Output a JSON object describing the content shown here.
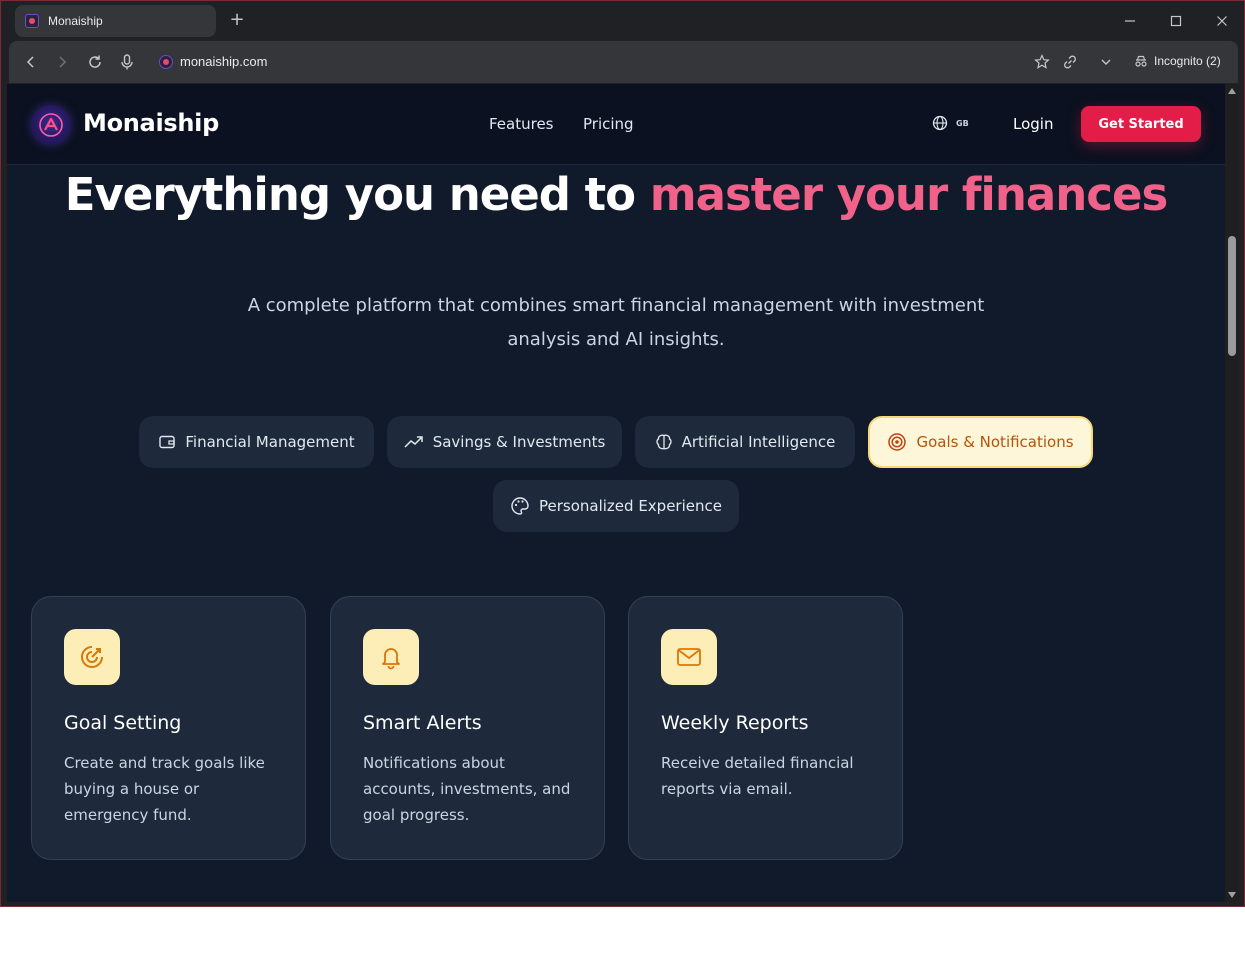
{
  "browser": {
    "tab_title": "Monaiship",
    "new_tab": "+",
    "url": "monaiship.com",
    "incognito_label": "Incognito (2)"
  },
  "site": {
    "brand": "Monaiship",
    "nav": [
      "Features",
      "Pricing"
    ],
    "language": "GB",
    "login": "Login",
    "cta": "Get Started"
  },
  "hero": {
    "title_part1": "Everything you need to ",
    "title_accent": "master your finances",
    "subtitle": "A complete platform that combines smart financial management with investment analysis and AI insights."
  },
  "tabs": [
    {
      "label": "Financial Management",
      "icon": "wallet-icon",
      "active": false
    },
    {
      "label": "Savings & Investments",
      "icon": "trending-up-icon",
      "active": false
    },
    {
      "label": "Artificial Intelligence",
      "icon": "brain-icon",
      "active": false
    },
    {
      "label": "Goals & Notifications",
      "icon": "target-icon",
      "active": true
    },
    {
      "label": "Personalized Experience",
      "icon": "palette-icon",
      "active": false
    }
  ],
  "cards": [
    {
      "title": "Goal Setting",
      "description": "Create and track goals like buying a house or emergency fund.",
      "icon": "goal-icon"
    },
    {
      "title": "Smart Alerts",
      "description": "Notifications about accounts, investments, and goal progress.",
      "icon": "bell-icon"
    },
    {
      "title": "Weekly Reports",
      "description": "Receive detailed financial reports via email.",
      "icon": "mail-icon"
    }
  ],
  "colors": {
    "page_bg": "#111a2b",
    "header_bg": "#0b1120",
    "accent_pink": "#f0628a",
    "cta_red": "#e11d48",
    "card_bg": "#1e293b",
    "icon_bg": "#fdedb6",
    "icon_fg": "#d97706"
  }
}
